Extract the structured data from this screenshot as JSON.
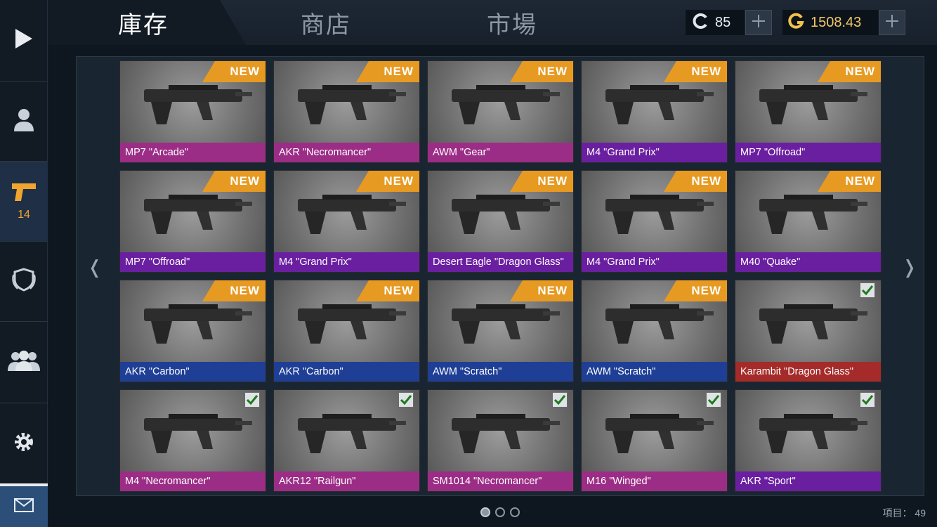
{
  "tabs": [
    {
      "label": "庫存",
      "active": true
    },
    {
      "label": "商店",
      "active": false
    },
    {
      "label": "市場",
      "active": false
    }
  ],
  "currency": {
    "credits": {
      "value": "85",
      "icon": "credit-c-icon"
    },
    "gold": {
      "value": "1508.43",
      "icon": "gold-g-icon"
    }
  },
  "sidebar": {
    "items": [
      {
        "name": "play",
        "icon": "play-icon"
      },
      {
        "name": "profile",
        "icon": "user-icon"
      },
      {
        "name": "inventory",
        "icon": "pistol-icon",
        "count": "14"
      },
      {
        "name": "clan",
        "icon": "shield-icon"
      },
      {
        "name": "friends",
        "icon": "group-icon"
      },
      {
        "name": "settings",
        "icon": "gear-icon"
      },
      {
        "name": "mail",
        "icon": "mail-icon"
      }
    ]
  },
  "rarity_colors": {
    "magenta": "#9c2d86",
    "purple": "#6a1fa0",
    "blue": "#1f3f96",
    "red": "#a42b29"
  },
  "badge_new_label": "NEW",
  "items": [
    {
      "label": "MP7 \"Arcade\"",
      "rarity": "magenta",
      "badge": "new"
    },
    {
      "label": "AKR \"Necromancer\"",
      "rarity": "magenta",
      "badge": "new"
    },
    {
      "label": "AWM \"Gear\"",
      "rarity": "magenta",
      "badge": "new"
    },
    {
      "label": "M4 \"Grand Prix\"",
      "rarity": "purple",
      "badge": "new"
    },
    {
      "label": "MP7 \"Offroad\"",
      "rarity": "purple",
      "badge": "new"
    },
    {
      "label": "MP7 \"Offroad\"",
      "rarity": "purple",
      "badge": "new"
    },
    {
      "label": "M4 \"Grand Prix\"",
      "rarity": "purple",
      "badge": "new"
    },
    {
      "label": "Desert Eagle \"Dragon Glass\"",
      "rarity": "purple",
      "badge": "new"
    },
    {
      "label": "M4 \"Grand Prix\"",
      "rarity": "purple",
      "badge": "new"
    },
    {
      "label": "M40 \"Quake\"",
      "rarity": "purple",
      "badge": "new"
    },
    {
      "label": "AKR \"Carbon\"",
      "rarity": "blue",
      "badge": "new"
    },
    {
      "label": "AKR \"Carbon\"",
      "rarity": "blue",
      "badge": "new"
    },
    {
      "label": "AWM \"Scratch\"",
      "rarity": "blue",
      "badge": "new"
    },
    {
      "label": "AWM \"Scratch\"",
      "rarity": "blue",
      "badge": "new"
    },
    {
      "label": "Karambit \"Dragon Glass\"",
      "rarity": "red",
      "badge": "check"
    },
    {
      "label": "M4 \"Necromancer\"",
      "rarity": "magenta",
      "badge": "check"
    },
    {
      "label": "AKR12 \"Railgun\"",
      "rarity": "magenta",
      "badge": "check"
    },
    {
      "label": "SM1014 \"Necromancer\"",
      "rarity": "magenta",
      "badge": "check"
    },
    {
      "label": "M16 \"Winged\"",
      "rarity": "magenta",
      "badge": "check"
    },
    {
      "label": "AKR \"Sport\"",
      "rarity": "purple",
      "badge": "check"
    }
  ],
  "pager": {
    "pages": 3,
    "current": 1
  },
  "footer": {
    "items_label": "項目： 49"
  }
}
